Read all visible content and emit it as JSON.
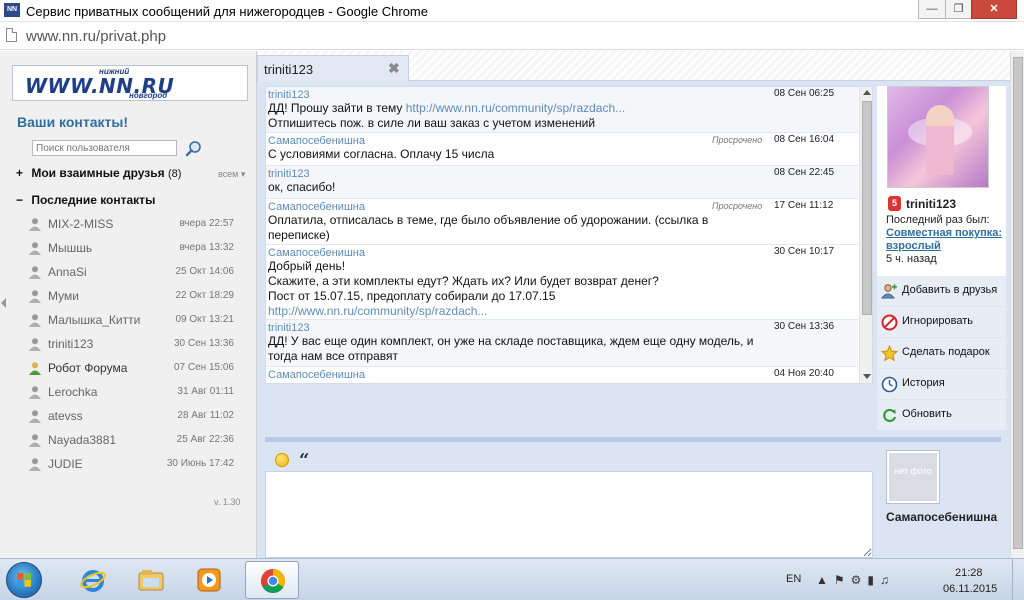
{
  "window": {
    "app_icon": "NN",
    "title": "Сервис приватных сообщений для нижегородцев - Google Chrome",
    "controls": [
      "minimize-icon",
      "maximize-icon",
      "close-icon"
    ]
  },
  "browser": {
    "url": "www.nn.ru/privat.php"
  },
  "sidebar": {
    "logo": {
      "main": "WWW.NN.RU",
      "top": "нижний",
      "bottom": "новгород"
    },
    "heading": "Ваши контакты!",
    "search_placeholder": "Поиск пользователя",
    "friends_section": {
      "toggle": "+",
      "label": "Мои взаимные друзья",
      "count": "(8)",
      "all_link": "всем"
    },
    "recent_section": {
      "toggle": "−",
      "label": "Последние контакты"
    },
    "contacts": [
      {
        "name": "MIX-2-MISS",
        "time": "вчера 22:57",
        "online": false
      },
      {
        "name": "Мышшь",
        "time": "вчера 13:32",
        "online": false
      },
      {
        "name": "AnnaSi",
        "time": "25 Окт 14:06",
        "online": false
      },
      {
        "name": "Муми",
        "time": "22 Окт 18:29",
        "online": false
      },
      {
        "name": "Малышка_Китти",
        "time": "09 Окт 13:21",
        "online": false
      },
      {
        "name": "triniti123",
        "time": "30 Сен 13:36",
        "online": false
      },
      {
        "name": "Робот Форума",
        "time": "07 Сен 15:06",
        "online": true
      },
      {
        "name": "Lerochka",
        "time": "31 Авг 01:11",
        "online": false
      },
      {
        "name": "atevss",
        "time": "28 Авг 11:02",
        "online": false
      },
      {
        "name": "Nayada3881",
        "time": "25 Авг 22:36",
        "online": false
      },
      {
        "name": "JUDIE",
        "time": "30 Июнь 17:42",
        "online": false
      }
    ],
    "version": "v. 1.30"
  },
  "tab": {
    "label": "triniti123",
    "close": "✖"
  },
  "messages": [
    {
      "author": "triniti123",
      "status": "",
      "date": "08 Сен 06:25",
      "lines": [
        "ДД! Прошу зайти в тему ",
        "Отпишитесь пож. в силе ли ваш заказ с учетом изменений"
      ],
      "link": "http://www.nn.ru/community/sp/razdach...",
      "alt": true
    },
    {
      "author": "Самапосебенишна",
      "status": "Просрочено",
      "date": "08 Сен 16:04",
      "lines": [
        "С условиями согласна. Оплачу 15 числа"
      ],
      "alt": false
    },
    {
      "author": "triniti123",
      "status": "",
      "date": "08 Сен 22:45",
      "lines": [
        "ок, спасибо!"
      ],
      "alt": true
    },
    {
      "author": "Самапосебенишна",
      "status": "Просрочено",
      "date": "17 Сен 11:12",
      "lines": [
        "Оплатила, отписалась в теме, где было объявление об удорожании. (ссылка в переписке)"
      ],
      "alt": false
    },
    {
      "author": "Самапосебенишна",
      "status": "",
      "date": "30 Сен 10:17",
      "lines": [
        "Добрый день!",
        "Скажите, а эти комплекты едут? Ждать их? Или будет возврат денег?",
        "Пост от 15.07.15, предоплату собирали до 17.07.15"
      ],
      "link": "http://www.nn.ru/community/sp/razdach...",
      "alt": false
    },
    {
      "author": "triniti123",
      "status": "",
      "date": "30 Сен 13:36",
      "lines": [
        "ДД! У вас еще один комплект, он уже на складе поставщика, ждем еще одну модель, и тогда нам все отправят"
      ],
      "alt": true
    },
    {
      "author": "Самапосебенишна",
      "status": "",
      "date": "04 Ноя 20:40",
      "lines": [
        ""
      ],
      "alt": false
    }
  ],
  "profile": {
    "name": "triniti123",
    "badge": "5",
    "last_seen_label": "Последний раз был:",
    "last_seen_place": "Совместная покупка: взрослый",
    "last_seen_time": "5 ч. назад"
  },
  "actions": [
    {
      "label": "Добавить в друзья",
      "icon": "add-friend-icon"
    },
    {
      "label": "Игнорировать",
      "icon": "ignore-icon"
    },
    {
      "label": "Сделать подарок",
      "icon": "gift-icon"
    },
    {
      "label": "История",
      "icon": "history-icon"
    },
    {
      "label": "Обновить",
      "icon": "refresh-icon"
    }
  ],
  "compose": {
    "recipient_photo_text": "нет фото",
    "recipient_name": "Самапосебенишна",
    "tools": [
      "smile-icon",
      "quote-icon"
    ]
  },
  "taskbar": {
    "apps": [
      "internet-explorer-icon",
      "file-explorer-icon",
      "media-player-icon",
      "chrome-icon"
    ],
    "language": "EN",
    "time": "21:28",
    "date": "06.11.2015"
  },
  "colors": {
    "accent": "#2e6f9e",
    "link": "#5e8cb6",
    "panel": "#dbe4f2"
  }
}
